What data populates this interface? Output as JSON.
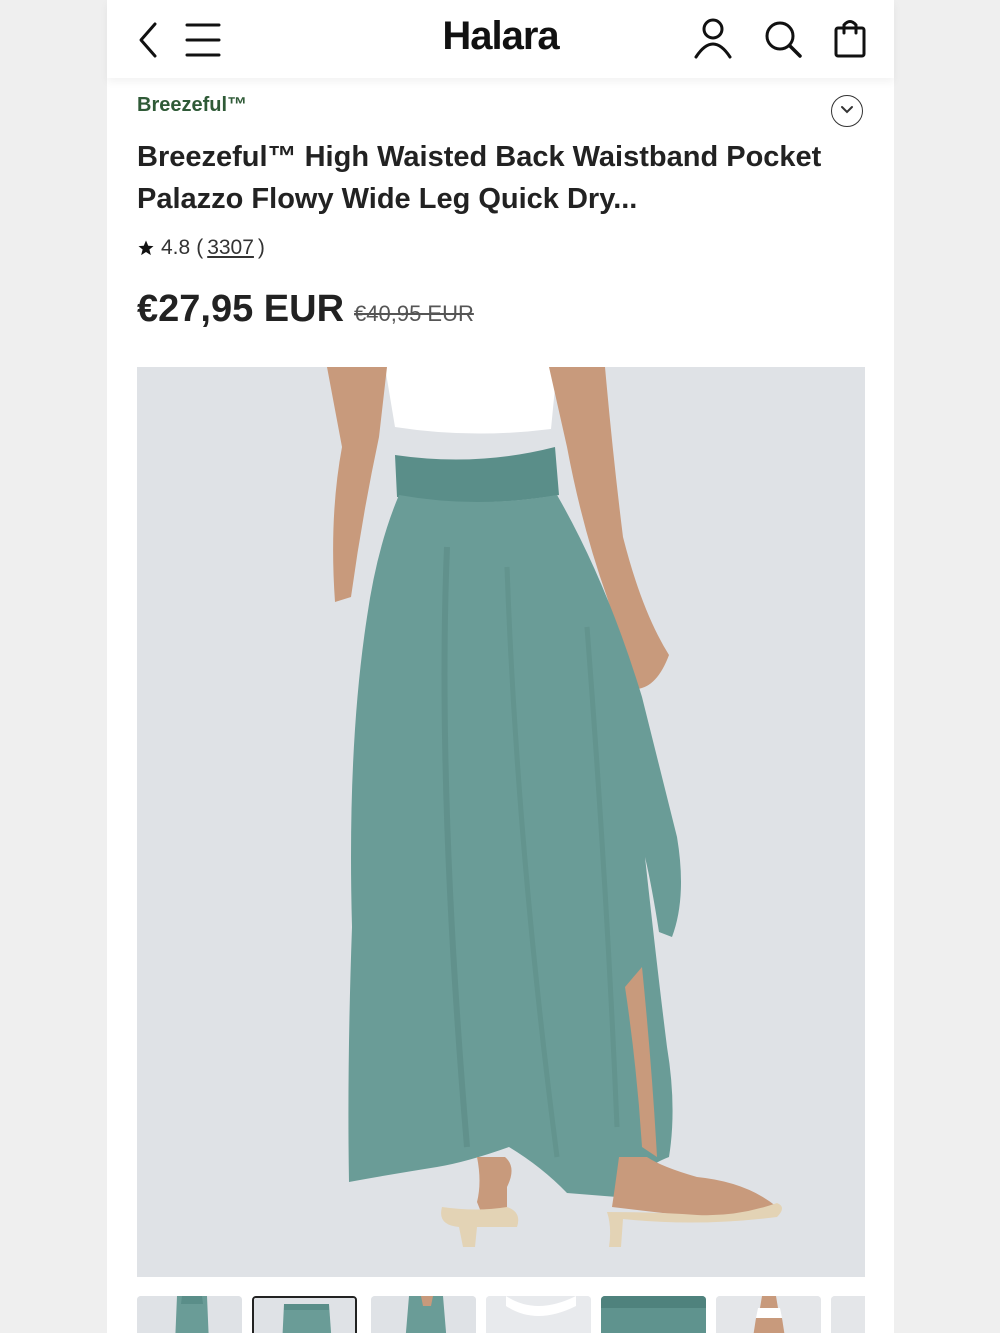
{
  "header": {
    "logo": "Halara",
    "icons": [
      "back-icon",
      "menu-icon",
      "account-icon",
      "search-icon",
      "bag-icon"
    ]
  },
  "product": {
    "brand": "Breezeful™",
    "title": "Breezeful™ High Waisted Back Waistband Pocket Palazzo Flowy Wide Leg Quick Dry...",
    "rating": "4.8",
    "rating_open": "(",
    "review_count": "3307",
    "rating_close": ")",
    "price": "€27,95 EUR",
    "original_price": "€40,95 EUR"
  },
  "gallery": {
    "selected_index": 1,
    "thumbnail_count": 7
  },
  "colors": {
    "brand_green": "#2f5a37",
    "pants_teal": "#6a9c97",
    "photo_bg": "#dfe2e6"
  }
}
